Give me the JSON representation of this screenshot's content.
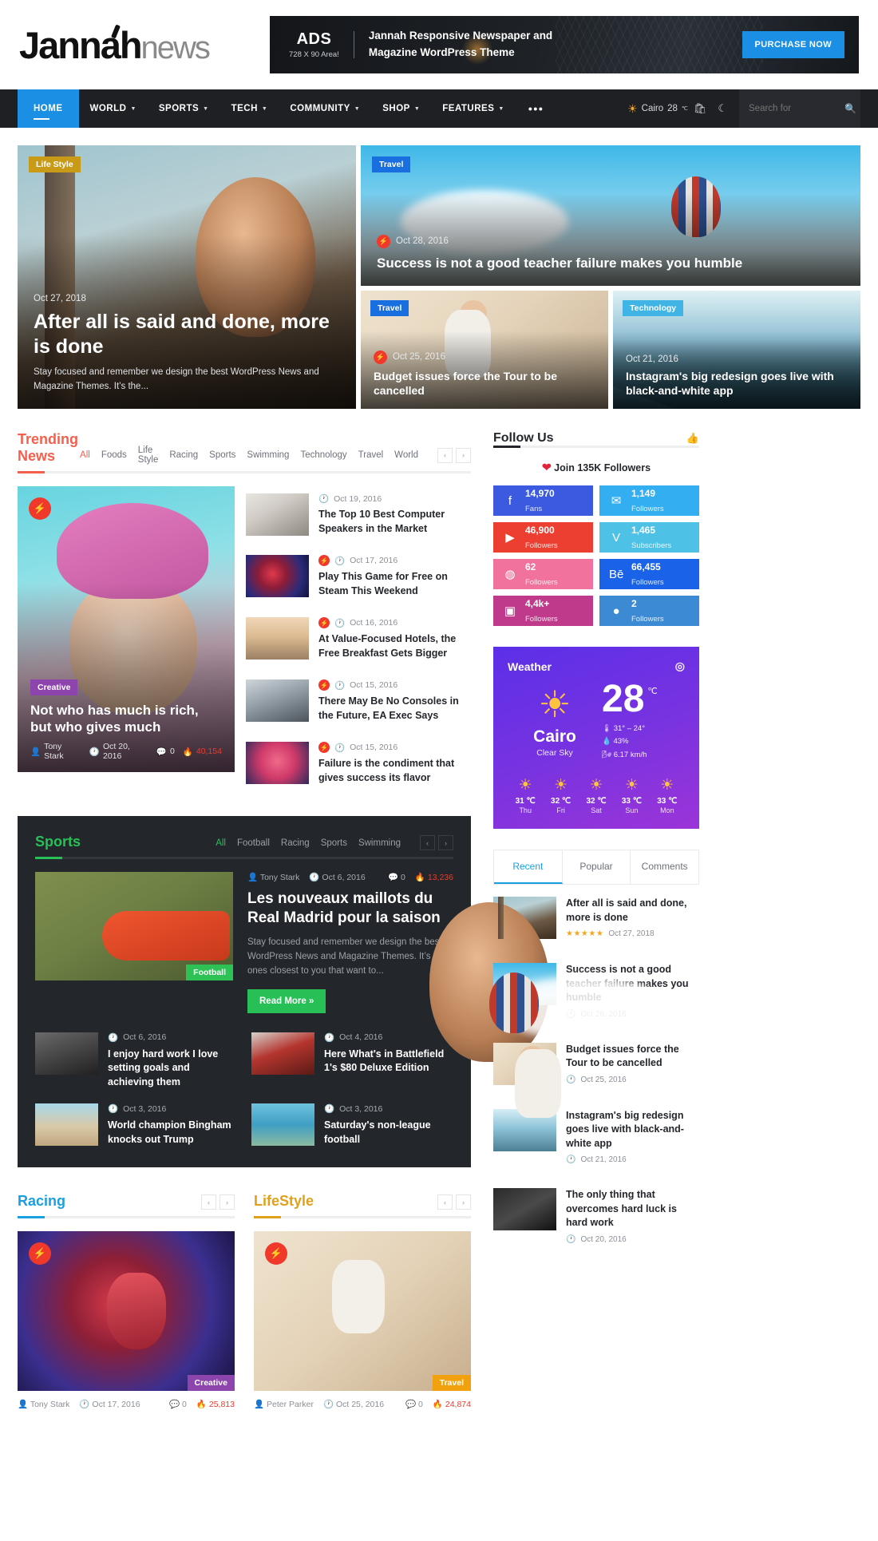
{
  "brand": {
    "name_bold": "Jannah",
    "name_light": "news"
  },
  "ad": {
    "label": "ADS",
    "size": "728 X 90 Area!",
    "line1": "Jannah Responsive Newspaper and",
    "line2": "Magazine WordPress Theme",
    "button": "PURCHASE NOW"
  },
  "nav": {
    "items": [
      {
        "label": "HOME",
        "caret": false,
        "active": true
      },
      {
        "label": "WORLD",
        "caret": true,
        "active": false
      },
      {
        "label": "SPORTS",
        "caret": true,
        "active": false
      },
      {
        "label": "TECH",
        "caret": true,
        "active": false
      },
      {
        "label": "COMMUNITY",
        "caret": true,
        "active": false
      },
      {
        "label": "SHOP",
        "caret": true,
        "active": false
      },
      {
        "label": "FEATURES",
        "caret": true,
        "active": false
      }
    ],
    "more": "•••",
    "weather_city": "Cairo",
    "weather_temp": "28",
    "weather_unit": "℃",
    "search_placeholder": "Search for"
  },
  "hero": {
    "main": {
      "category": "Life Style",
      "date": "Oct 27, 2018",
      "title": "After all is said and done, more is done",
      "excerpt": "Stay focused and remember we design the best WordPress News and Magazine Themes. It’s the..."
    },
    "top": {
      "category": "Travel",
      "date": "Oct 28, 2016",
      "title": "Success is not a good teacher failure makes you humble"
    },
    "bottom_left": {
      "category": "Travel",
      "date": "Oct 25, 2016",
      "title": "Budget issues force the Tour to be cancelled"
    },
    "bottom_right": {
      "category": "Technology",
      "date": "Oct 21, 2016",
      "title": "Instagram's big redesign goes live with black-and-white app"
    }
  },
  "trending": {
    "title": "Trending News",
    "filters": [
      "All",
      "Foods",
      "Life Style",
      "Racing",
      "Sports",
      "Swimming",
      "Technology",
      "Travel",
      "World"
    ],
    "active_filter": "All",
    "featured": {
      "category": "Creative",
      "title": "Not who has much is rich, but who gives much",
      "author": "Tony Stark",
      "date": "Oct 20, 2016",
      "comments": "0",
      "views": "40,154"
    },
    "list": [
      {
        "date": "Oct 19, 2016",
        "title": "The Top 10 Best Computer Speakers in the Market",
        "hot": false
      },
      {
        "date": "Oct 17, 2016",
        "title": "Play This Game for Free on Steam This Weekend",
        "hot": true
      },
      {
        "date": "Oct 16, 2016",
        "title": "At Value-Focused Hotels, the Free Breakfast Gets Bigger",
        "hot": true
      },
      {
        "date": "Oct 15, 2016",
        "title": "There May Be No Consoles in the Future, EA Exec Says",
        "hot": true
      },
      {
        "date": "Oct 15, 2016",
        "title": "Failure is the condiment that gives success its flavor",
        "hot": true
      }
    ]
  },
  "sidebar": {
    "follow": {
      "title": "Follow Us",
      "join_text": "Join 135K Followers",
      "networks": [
        {
          "icon": "facebook-icon",
          "glyph": "f",
          "count": "14,970",
          "label": "Fans",
          "color": "#3b5ae0"
        },
        {
          "icon": "twitter-icon",
          "glyph": "✉",
          "count": "1,149",
          "label": "Followers",
          "color": "#33aef0"
        },
        {
          "icon": "youtube-icon",
          "glyph": "▶",
          "count": "46,900",
          "label": "Followers",
          "color": "#ec3e31"
        },
        {
          "icon": "vimeo-icon",
          "glyph": "V",
          "count": "1,465",
          "label": "Subscribers",
          "color": "#4ec2e6"
        },
        {
          "icon": "dribbble-icon",
          "glyph": "◎",
          "count": "62",
          "label": "Followers",
          "color": "#f0729d"
        },
        {
          "icon": "behance-icon",
          "glyph": "Bē",
          "count": "66,455",
          "label": "Followers",
          "color": "#1a63e8"
        },
        {
          "icon": "instagram-icon",
          "glyph": "▢",
          "count": "4,4k+",
          "label": "Followers",
          "color": "#bf3a8a"
        },
        {
          "icon": "github-icon",
          "glyph": "●",
          "count": "2",
          "label": "Followers",
          "color": "#3d8ad4"
        }
      ]
    },
    "weather": {
      "title": "Weather",
      "city": "Cairo",
      "desc": "Clear Sky",
      "temp": "28",
      "unit": "℃",
      "range": "31° – 24°",
      "humidity": "43%",
      "wind": "6.17 km/h",
      "forecast": [
        {
          "temp": "31 ℃",
          "day": "Thu"
        },
        {
          "temp": "32 ℃",
          "day": "Fri"
        },
        {
          "temp": "32 ℃",
          "day": "Sat"
        },
        {
          "temp": "33 ℃",
          "day": "Sun"
        },
        {
          "temp": "33 ℃",
          "day": "Mon"
        }
      ]
    },
    "tabs": [
      {
        "label": "Recent",
        "active": true
      },
      {
        "label": "Popular",
        "active": false
      },
      {
        "label": "Comments",
        "active": false
      }
    ],
    "recent": [
      {
        "title": "After all is said and done, more is done",
        "date": "Oct 27, 2018",
        "stars": "★★★★★"
      },
      {
        "title": "Success is not a good teacher failure makes you humble",
        "date": "Oct 28, 2016",
        "stars": ""
      },
      {
        "title": "Budget issues force the Tour to be cancelled",
        "date": "Oct 25, 2016",
        "stars": ""
      },
      {
        "title": "Instagram's big redesign goes live with black-and-white app",
        "date": "Oct 21, 2016",
        "stars": ""
      },
      {
        "title": "The only thing that overcomes hard luck is hard work",
        "date": "Oct 20, 2016",
        "stars": ""
      }
    ]
  },
  "sports": {
    "title": "Sports",
    "filters": [
      "All",
      "Football",
      "Racing",
      "Sports",
      "Swimming"
    ],
    "active_filter": "All",
    "featured": {
      "category": "Football",
      "author": "Tony Stark",
      "date": "Oct 6, 2016",
      "comments": "0",
      "views": "13,236",
      "title": "Les nouveaux maillots du Real Madrid pour la saison",
      "excerpt": "Stay focused and remember we design the best WordPress News and Magazine Themes. It’s the ones closest to you that want to...",
      "button": "Read More »"
    },
    "items": [
      {
        "date": "Oct 6, 2016",
        "title": "I enjoy hard work I love setting goals and achieving them"
      },
      {
        "date": "Oct 4, 2016",
        "title": "Here What's in Battlefield 1's $80 Deluxe Edition"
      },
      {
        "date": "Oct 3, 2016",
        "title": "World champion Bingham knocks out Trump"
      },
      {
        "date": "Oct 3, 2016",
        "title": "Saturday's non-league football"
      }
    ]
  },
  "bottom": {
    "racing": {
      "title": "Racing",
      "category": "Creative",
      "author": "Tony Stark",
      "date": "Oct 17, 2016",
      "comments": "0",
      "views": "25,813"
    },
    "lifestyle": {
      "title": "LifeStyle",
      "category": "Travel",
      "author": "Peter Parker",
      "date": "Oct 25, 2016",
      "comments": "0",
      "views": "24,874"
    }
  }
}
